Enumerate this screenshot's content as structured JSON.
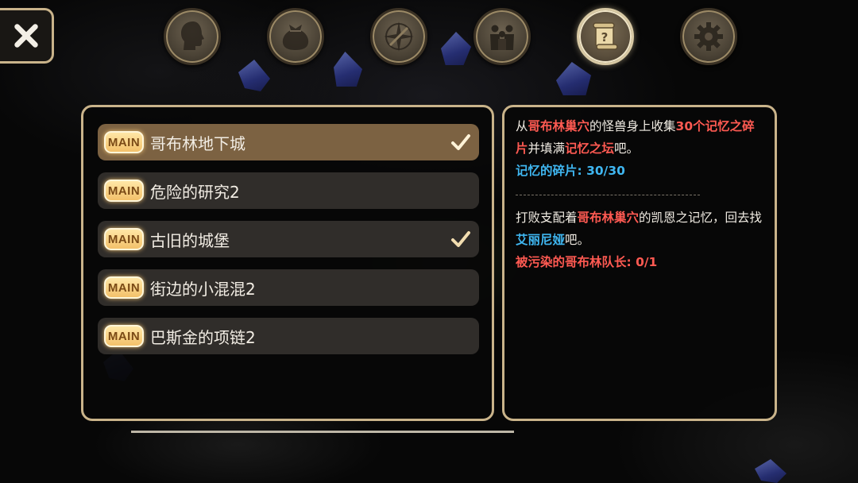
{
  "close_button": {
    "icon": "close-x-icon"
  },
  "tabs": [
    {
      "name": "character",
      "icon": "head-silhouette-icon",
      "active": false
    },
    {
      "name": "inventory",
      "icon": "bag-icon",
      "active": false
    },
    {
      "name": "map",
      "icon": "compass-icon",
      "active": false
    },
    {
      "name": "party",
      "icon": "people-icon",
      "active": false
    },
    {
      "name": "quests",
      "icon": "scroll-icon",
      "active": true
    },
    {
      "name": "settings",
      "icon": "gear-icon",
      "active": false
    }
  ],
  "quests": [
    {
      "badge": "MAIN",
      "title": "哥布林地下城",
      "completed": true,
      "selected": true
    },
    {
      "badge": "MAIN",
      "title": "危险的研究2",
      "completed": false,
      "selected": false
    },
    {
      "badge": "MAIN",
      "title": "古旧的城堡",
      "completed": true,
      "selected": false
    },
    {
      "badge": "MAIN",
      "title": "街边的小混混2",
      "completed": false,
      "selected": false
    },
    {
      "badge": "MAIN",
      "title": "巴斯金的项链2",
      "completed": false,
      "selected": false
    }
  ],
  "detail": {
    "objective1": {
      "t1": "从",
      "r1": "哥布林巢穴",
      "t2": "的怪兽身上收集",
      "r2": "30个记忆之碎片",
      "t3": "并填满",
      "r3": "记忆之坛",
      "t4": "吧。"
    },
    "progress1": "记忆的碎片: 30/30",
    "objective2": {
      "t1": "打败支配着",
      "r1": "哥布林巢穴",
      "t2": "的凯恩之记忆，回去找",
      "b1": "艾丽尼娅",
      "t3": "吧。"
    },
    "progress2": "被污染的哥布林队长: 0/1"
  },
  "colors": {
    "panel_border": "#c9b38a",
    "selected_row": "#7c6242",
    "row": "#302d2a",
    "highlight_red": "#ff5a52",
    "highlight_blue": "#3fb6f0",
    "badge": "#f3c16a"
  }
}
